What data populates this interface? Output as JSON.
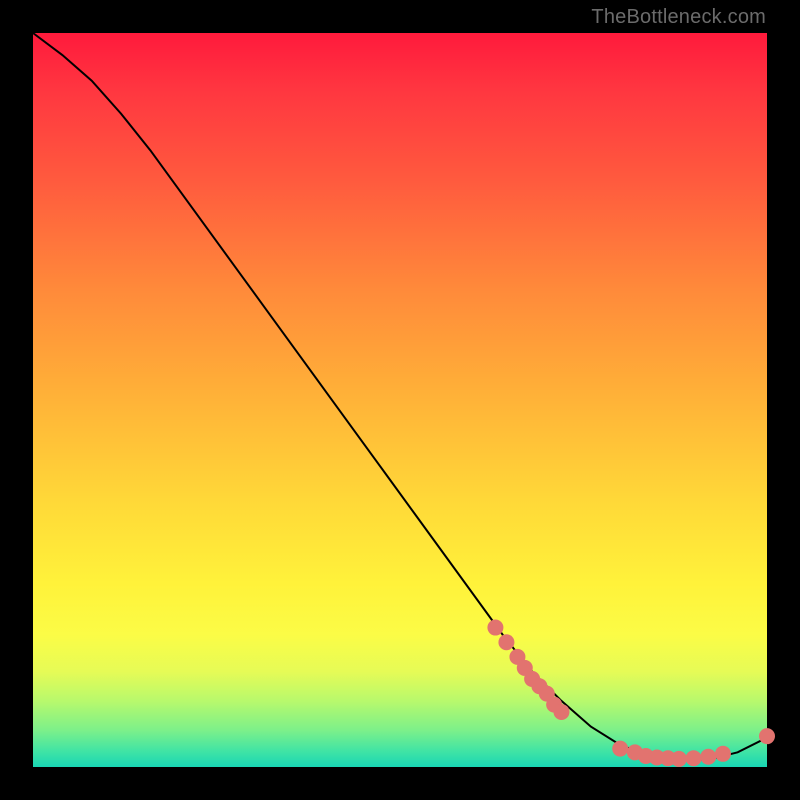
{
  "watermark": "TheBottleneck.com",
  "chart_data": {
    "type": "line",
    "title": "",
    "xlabel": "",
    "ylabel": "",
    "xlim": [
      0,
      100
    ],
    "ylim": [
      0,
      100
    ],
    "series": [
      {
        "name": "curve",
        "x": [
          0,
          4,
          8,
          12,
          16,
          20,
          24,
          28,
          32,
          36,
          40,
          44,
          48,
          52,
          56,
          60,
          64,
          68,
          72,
          76,
          80,
          84,
          88,
          92,
          96,
          100
        ],
        "y": [
          100,
          97,
          93.5,
          89,
          84,
          78.5,
          73,
          67.5,
          62,
          56.5,
          51,
          45.5,
          40,
          34.5,
          29,
          23.5,
          18,
          13,
          9,
          5.5,
          3,
          1.5,
          1,
          1,
          2,
          4
        ],
        "color": "#000000",
        "width": 2
      }
    ],
    "markers": {
      "name": "dots",
      "color": "#e2736f",
      "radius": 8,
      "points": [
        {
          "x": 63,
          "y": 19
        },
        {
          "x": 64.5,
          "y": 17
        },
        {
          "x": 66,
          "y": 15
        },
        {
          "x": 67,
          "y": 13.5
        },
        {
          "x": 68,
          "y": 12
        },
        {
          "x": 69,
          "y": 11
        },
        {
          "x": 70,
          "y": 10
        },
        {
          "x": 71,
          "y": 8.5
        },
        {
          "x": 72,
          "y": 7.5
        },
        {
          "x": 80,
          "y": 2.5
        },
        {
          "x": 82,
          "y": 2
        },
        {
          "x": 83.5,
          "y": 1.5
        },
        {
          "x": 85,
          "y": 1.3
        },
        {
          "x": 86.5,
          "y": 1.2
        },
        {
          "x": 88,
          "y": 1.1
        },
        {
          "x": 90,
          "y": 1.2
        },
        {
          "x": 92,
          "y": 1.4
        },
        {
          "x": 94,
          "y": 1.8
        },
        {
          "x": 100,
          "y": 4.2
        }
      ]
    }
  }
}
